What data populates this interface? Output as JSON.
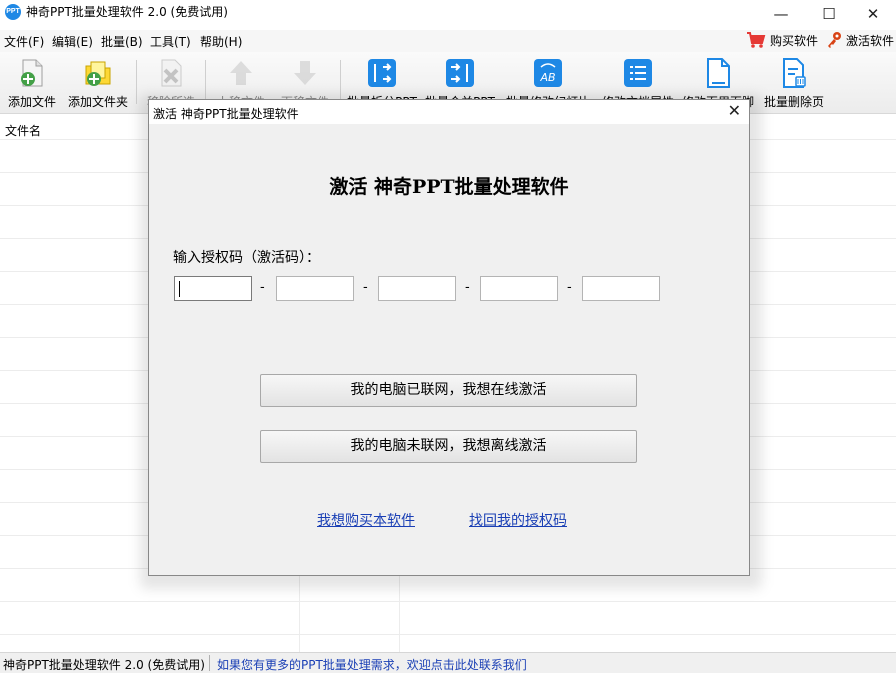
{
  "window": {
    "title": "神奇PPT批量处理软件 2.0 (免费试用)",
    "icon_text": "PPT",
    "min_glyph": "—",
    "max_glyph": "☐",
    "close_glyph": "✕"
  },
  "menu": {
    "items": [
      "文件(F)",
      "编辑(E)",
      "批量(B)",
      "工具(T)",
      "帮助(H)"
    ],
    "buy": "购买软件",
    "activate": "激活软件"
  },
  "toolbar": {
    "add_file": "添加文件",
    "add_folder": "添加文件夹",
    "remove_selected": "移除所选",
    "move_up": "上移文件",
    "move_down": "下移文件",
    "batch_split": "批量拆分PPT",
    "batch_merge": "批量合并PPT",
    "batch_edit_slides": "批量修改幻灯片",
    "edit_doc_props": "修改文档属性",
    "edit_header_footer": "修改页眉页脚",
    "batch_delete_pages": "批量删除页"
  },
  "list": {
    "header": "文件名"
  },
  "status": {
    "left": "神奇PPT批量处理软件 2.0 (免费试用)",
    "link": "如果您有更多的PPT批量处理需求，欢迎点击此处联系我们"
  },
  "dialog": {
    "title": "激活 神奇PPT批量处理软件",
    "heading": "激活 神奇PPT批量处理软件",
    "code_label": "输入授权码（激活码）：",
    "dash": "-",
    "online_button": "我的电脑已联网，我想在线激活",
    "offline_button": "我的电脑未联网，我想离线激活",
    "buy_link": "我想购买本软件",
    "recover_link": "找回我的授权码",
    "code_values": [
      "",
      "",
      "",
      "",
      ""
    ]
  },
  "colors": {
    "accent_blue": "#1e88e5",
    "link_blue": "#1a3fb5",
    "cart_red": "#e53935"
  }
}
